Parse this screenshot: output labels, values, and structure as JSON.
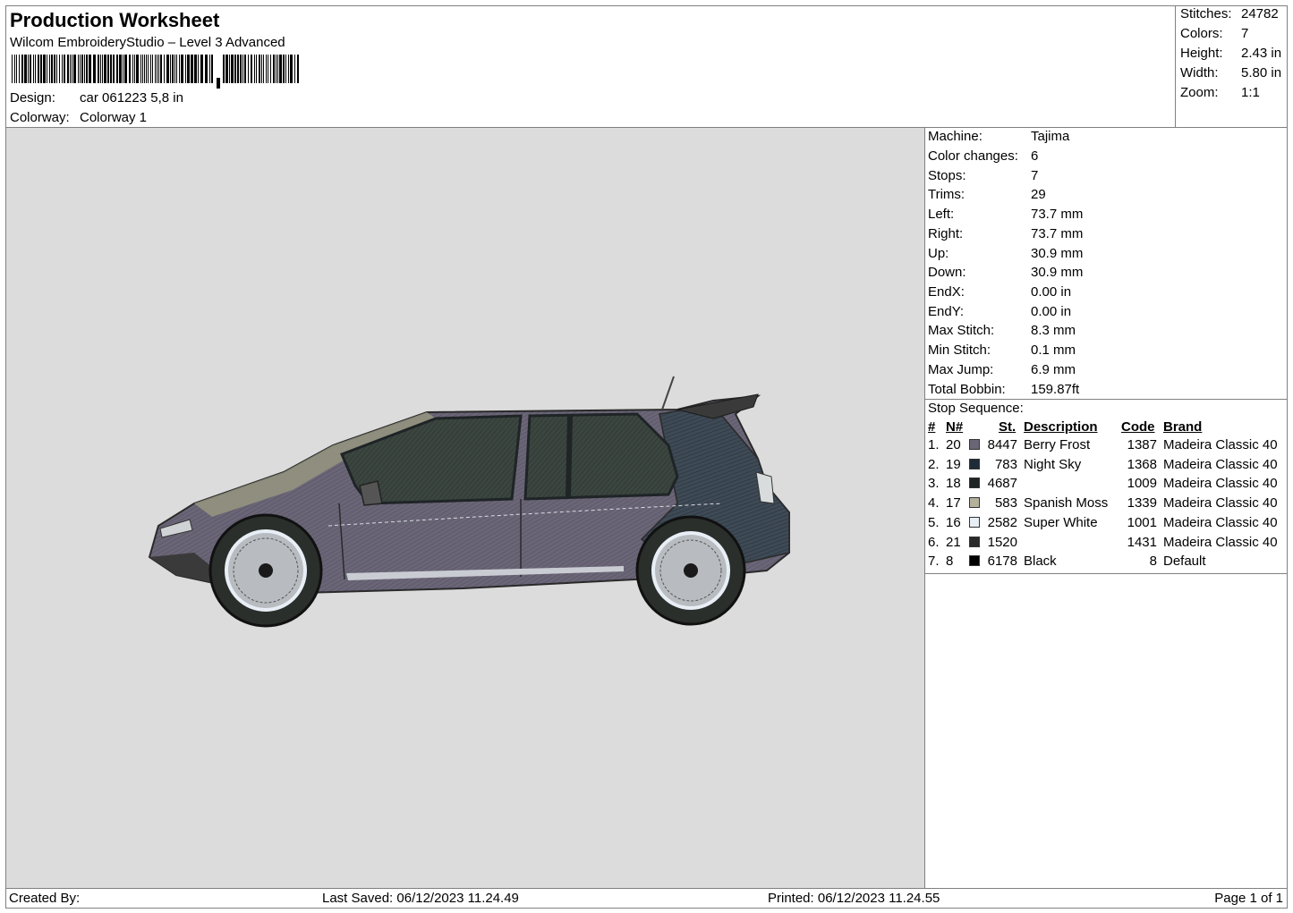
{
  "header": {
    "title": "Production Worksheet",
    "subtitle": "Wilcom EmbroideryStudio – Level 3 Advanced",
    "design_label": "Design:",
    "design_value": "car 061223 5,8 in",
    "colorway_label": "Colorway:",
    "colorway_value": "Colorway 1"
  },
  "summary": [
    {
      "label": "Stitches:",
      "value": "24782"
    },
    {
      "label": "Colors:",
      "value": "7"
    },
    {
      "label": "Height:",
      "value": "2.43 in"
    },
    {
      "label": "Width:",
      "value": "5.80 in"
    },
    {
      "label": "Zoom:",
      "value": "1:1"
    }
  ],
  "machine_info": [
    {
      "label": "Machine:",
      "value": "Tajima"
    },
    {
      "label": "Color changes:",
      "value": "6"
    },
    {
      "label": "Stops:",
      "value": "7"
    },
    {
      "label": "Trims:",
      "value": "29"
    },
    {
      "label": "Left:",
      "value": "73.7 mm"
    },
    {
      "label": "Right:",
      "value": "73.7 mm"
    },
    {
      "label": "Up:",
      "value": "30.9 mm"
    },
    {
      "label": "Down:",
      "value": "30.9 mm"
    },
    {
      "label": "EndX:",
      "value": "0.00 in"
    },
    {
      "label": "EndY:",
      "value": "0.00 in"
    },
    {
      "label": "Max Stitch:",
      "value": "8.3 mm"
    },
    {
      "label": "Min Stitch:",
      "value": "0.1 mm"
    },
    {
      "label": "Max Jump:",
      "value": "6.9 mm"
    },
    {
      "label": "Total Bobbin:",
      "value": "159.87ft"
    }
  ],
  "stop_sequence": {
    "title": "Stop Sequence:",
    "headers": {
      "num": "#",
      "n": "N#",
      "st": "St.",
      "description": "Description",
      "code": "Code",
      "brand": "Brand"
    },
    "rows": [
      {
        "num": "1.",
        "n": "20",
        "color": "#6b6676",
        "st": "8447",
        "description": "Berry Frost",
        "code": "1387",
        "brand": "Madeira Classic 40"
      },
      {
        "num": "2.",
        "n": "19",
        "color": "#1e2b38",
        "st": "783",
        "description": "Night Sky",
        "code": "1368",
        "brand": "Madeira Classic 40"
      },
      {
        "num": "3.",
        "n": "18",
        "color": "#1f2426",
        "st": "4687",
        "description": "",
        "code": "1009",
        "brand": "Madeira Classic 40"
      },
      {
        "num": "4.",
        "n": "17",
        "color": "#b3b19b",
        "st": "583",
        "description": "Spanish Moss",
        "code": "1339",
        "brand": "Madeira Classic 40"
      },
      {
        "num": "5.",
        "n": "16",
        "color": "#e8eef5",
        "st": "2582",
        "description": "Super White",
        "code": "1001",
        "brand": "Madeira Classic 40"
      },
      {
        "num": "6.",
        "n": "21",
        "color": "#2a2a2a",
        "st": "1520",
        "description": "",
        "code": "1431",
        "brand": "Madeira Classic 40"
      },
      {
        "num": "7.",
        "n": "8",
        "color": "#000000",
        "st": "6178",
        "description": "Black",
        "code": "8",
        "brand": "Default"
      }
    ]
  },
  "footer": {
    "created_by": "Created By:",
    "last_saved": "Last Saved: 06/12/2023 11.24.49",
    "printed": "Printed: 06/12/2023 11.24.55",
    "page": "Page 1 of 1"
  }
}
